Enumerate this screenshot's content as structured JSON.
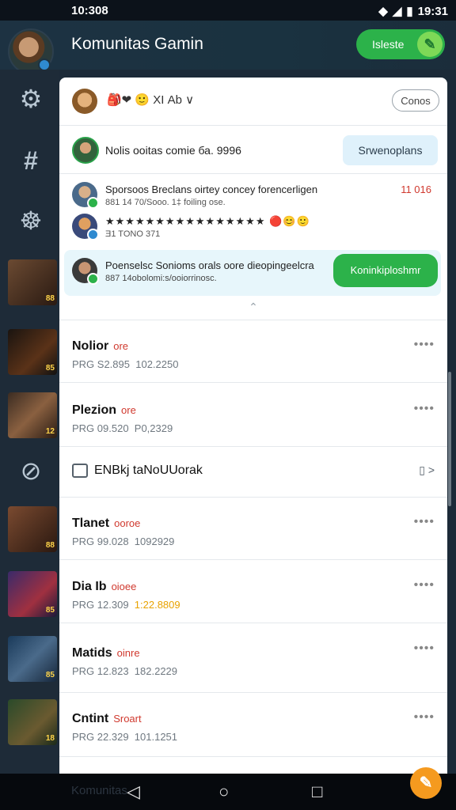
{
  "status": {
    "time_left": "10:308",
    "time_right": "19:31"
  },
  "header": {
    "title": "Komunitas Gamin",
    "button_label": "Isleste"
  },
  "topbar": {
    "emoji_text": "🎒❤ 🙂 ХI Аb ∨",
    "cancel_label": "Conos"
  },
  "notice": {
    "text": "Nolis ooitas comie ба. 9996",
    "button_label": "Srwenoplans"
  },
  "messages": [
    {
      "line1": "Sporsoos Breclans oirtey concey forencerligen",
      "line2": "881 14 70/Sooo. 1‡ foiling ose.",
      "stamp": "11 016"
    },
    {
      "line1": "★★★★★★★★★★★★★★★★ 🔴😊🙂",
      "line2": "Ǝ1 TONO 371",
      "stamp": ""
    }
  ],
  "highlight": {
    "line1": "Poenselsc Sonioms orals oore dieopingeelcra",
    "line2": "887 14obolomi:s/ooiorrinosc.",
    "button_label": "Koninkiploshmr"
  },
  "list": [
    {
      "name": "Nolior",
      "tag": "ore",
      "meta_a": "PRG S2.895",
      "meta_b": "102.2250"
    },
    {
      "name": "Plezion",
      "tag": "ore",
      "meta_a": "PRG 09.520",
      "meta_b": "P0,2329"
    }
  ],
  "section": {
    "label": "ENBkj taNoUUorak",
    "expand": "▯ >"
  },
  "list2": [
    {
      "name": "Tlanet",
      "tag": "ooroe",
      "meta_a": "PRG 99.028",
      "meta_b": "1092929"
    },
    {
      "name": "Dia Ib",
      "tag": "oioee",
      "meta_a": "PRG 12.309",
      "meta_b": "1:22.8809"
    },
    {
      "name": "Matids",
      "tag": "oinre",
      "meta_a": "PRG 12.823",
      "meta_b": "182.2229"
    },
    {
      "name": "Cntint",
      "tag": "Sroart",
      "meta_a": "PRG 22.329",
      "meta_b": "101.1251"
    }
  ],
  "rail_badges": [
    "88",
    "85",
    "12",
    "88",
    "85",
    "85",
    "18"
  ],
  "nav": {
    "ghost": "Komunitas",
    "fab_icon": "wrench-icon"
  },
  "colors": {
    "accent_green": "#2cb24a",
    "alert_red": "#d0392e",
    "fab_orange": "#f59a1f"
  }
}
